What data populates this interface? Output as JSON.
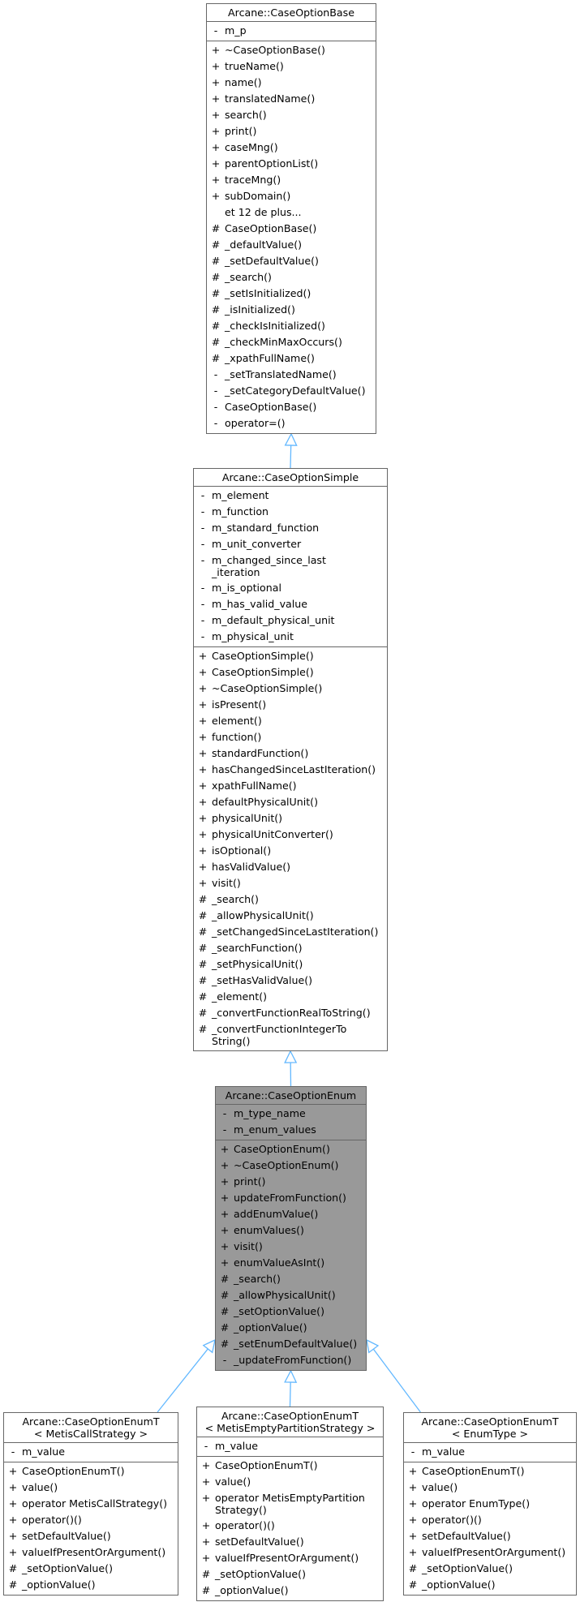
{
  "diagram": {
    "type": "class-inheritance",
    "edge_color": "#63b8ff",
    "highlight_color": "#999999",
    "classes": [
      {
        "id": "base",
        "title": "Arcane::CaseOptionBase",
        "attributes": [
          [
            "-",
            "m_p"
          ]
        ],
        "methods": [
          [
            "+",
            "~CaseOptionBase()"
          ],
          [
            "+",
            "trueName()"
          ],
          [
            "+",
            "name()"
          ],
          [
            "+",
            "translatedName()"
          ],
          [
            "+",
            "search()"
          ],
          [
            "+",
            "print()"
          ],
          [
            "+",
            "caseMng()"
          ],
          [
            "+",
            "parentOptionList()"
          ],
          [
            "+",
            "traceMng()"
          ],
          [
            "+",
            "subDomain()"
          ],
          [
            "",
            "et 12 de plus..."
          ],
          [
            "#",
            "CaseOptionBase()"
          ],
          [
            "#",
            "_defaultValue()"
          ],
          [
            "#",
            "_setDefaultValue()"
          ],
          [
            "#",
            "_search()"
          ],
          [
            "#",
            "_setIsInitialized()"
          ],
          [
            "#",
            "_isInitialized()"
          ],
          [
            "#",
            "_checkIsInitialized()"
          ],
          [
            "#",
            "_checkMinMaxOccurs()"
          ],
          [
            "#",
            "_xpathFullName()"
          ],
          [
            "-",
            "_setTranslatedName()"
          ],
          [
            "-",
            "_setCategoryDefaultValue()"
          ],
          [
            "-",
            "CaseOptionBase()"
          ],
          [
            "-",
            "operator=()"
          ]
        ]
      },
      {
        "id": "simple",
        "title": "Arcane::CaseOptionSimple",
        "attributes": [
          [
            "-",
            "m_element"
          ],
          [
            "-",
            "m_function"
          ],
          [
            "-",
            "m_standard_function"
          ],
          [
            "-",
            "m_unit_converter"
          ],
          [
            "-",
            "m_changed_since_last\n_iteration"
          ],
          [
            "-",
            "m_is_optional"
          ],
          [
            "-",
            "m_has_valid_value"
          ],
          [
            "-",
            "m_default_physical_unit"
          ],
          [
            "-",
            "m_physical_unit"
          ]
        ],
        "methods": [
          [
            "+",
            "CaseOptionSimple()"
          ],
          [
            "+",
            "CaseOptionSimple()"
          ],
          [
            "+",
            "~CaseOptionSimple()"
          ],
          [
            "+",
            "isPresent()"
          ],
          [
            "+",
            "element()"
          ],
          [
            "+",
            "function()"
          ],
          [
            "+",
            "standardFunction()"
          ],
          [
            "+",
            "hasChangedSinceLastIteration()"
          ],
          [
            "+",
            "xpathFullName()"
          ],
          [
            "+",
            "defaultPhysicalUnit()"
          ],
          [
            "+",
            "physicalUnit()"
          ],
          [
            "+",
            "physicalUnitConverter()"
          ],
          [
            "+",
            "isOptional()"
          ],
          [
            "+",
            "hasValidValue()"
          ],
          [
            "+",
            "visit()"
          ],
          [
            "#",
            "_search()"
          ],
          [
            "#",
            "_allowPhysicalUnit()"
          ],
          [
            "#",
            "_setChangedSinceLastIteration()"
          ],
          [
            "#",
            "_searchFunction()"
          ],
          [
            "#",
            "_setPhysicalUnit()"
          ],
          [
            "#",
            "_setHasValidValue()"
          ],
          [
            "#",
            "_element()"
          ],
          [
            "#",
            "_convertFunctionRealToString()"
          ],
          [
            "#",
            "_convertFunctionIntegerTo\nString()"
          ]
        ]
      },
      {
        "id": "enum",
        "title": "Arcane::CaseOptionEnum",
        "highlighted": true,
        "attributes": [
          [
            "-",
            "m_type_name"
          ],
          [
            "-",
            "m_enum_values"
          ]
        ],
        "methods": [
          [
            "+",
            "CaseOptionEnum()"
          ],
          [
            "+",
            "~CaseOptionEnum()"
          ],
          [
            "+",
            "print()"
          ],
          [
            "+",
            "updateFromFunction()"
          ],
          [
            "+",
            "addEnumValue()"
          ],
          [
            "+",
            "enumValues()"
          ],
          [
            "+",
            "visit()"
          ],
          [
            "+",
            "enumValueAsInt()"
          ],
          [
            "#",
            "_search()"
          ],
          [
            "#",
            "_allowPhysicalUnit()"
          ],
          [
            "#",
            "_setOptionValue()"
          ],
          [
            "#",
            "_optionValue()"
          ],
          [
            "#",
            "_setEnumDefaultValue()"
          ],
          [
            "-",
            "_updateFromFunction()"
          ]
        ]
      },
      {
        "id": "metis-call",
        "title": "Arcane::CaseOptionEnumT\n< MetisCallStrategy >",
        "attributes": [
          [
            "-",
            "m_value"
          ]
        ],
        "methods": [
          [
            "+",
            "CaseOptionEnumT()"
          ],
          [
            "+",
            "value()"
          ],
          [
            "+",
            "operator MetisCallStrategy()"
          ],
          [
            "+",
            "operator()()"
          ],
          [
            "+",
            "setDefaultValue()"
          ],
          [
            "+",
            "valueIfPresentOrArgument()"
          ],
          [
            "#",
            "_setOptionValue()"
          ],
          [
            "#",
            "_optionValue()"
          ]
        ]
      },
      {
        "id": "metis-empty",
        "title": "Arcane::CaseOptionEnumT\n< MetisEmptyPartitionStrategy >",
        "attributes": [
          [
            "-",
            "m_value"
          ]
        ],
        "methods": [
          [
            "+",
            "CaseOptionEnumT()"
          ],
          [
            "+",
            "value()"
          ],
          [
            "+",
            "operator MetisEmptyPartition\nStrategy()"
          ],
          [
            "+",
            "operator()()"
          ],
          [
            "+",
            "setDefaultValue()"
          ],
          [
            "+",
            "valueIfPresentOrArgument()"
          ],
          [
            "#",
            "_setOptionValue()"
          ],
          [
            "#",
            "_optionValue()"
          ]
        ]
      },
      {
        "id": "enum-type",
        "title": "Arcane::CaseOptionEnumT\n< EnumType >",
        "attributes": [
          [
            "-",
            "m_value"
          ]
        ],
        "methods": [
          [
            "+",
            "CaseOptionEnumT()"
          ],
          [
            "+",
            "value()"
          ],
          [
            "+",
            "operator EnumType()"
          ],
          [
            "+",
            "operator()()"
          ],
          [
            "+",
            "setDefaultValue()"
          ],
          [
            "+",
            "valueIfPresentOrArgument()"
          ],
          [
            "#",
            "_setOptionValue()"
          ],
          [
            "#",
            "_optionValue()"
          ]
        ]
      }
    ],
    "edges": [
      {
        "from": "simple",
        "to": "base",
        "kind": "inherits"
      },
      {
        "from": "enum",
        "to": "simple",
        "kind": "inherits"
      },
      {
        "from": "metis-call",
        "to": "enum",
        "kind": "inherits"
      },
      {
        "from": "metis-empty",
        "to": "enum",
        "kind": "inherits"
      },
      {
        "from": "enum-type",
        "to": "enum",
        "kind": "inherits"
      }
    ]
  }
}
